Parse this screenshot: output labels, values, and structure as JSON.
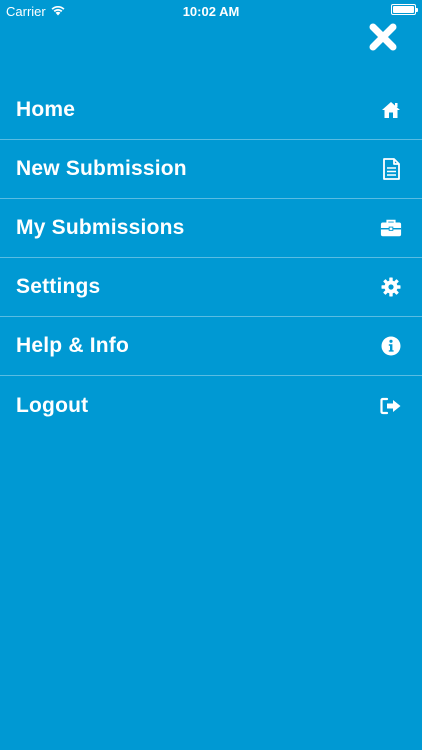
{
  "status_bar": {
    "carrier": "Carrier",
    "time": "10:02 AM"
  },
  "menu": {
    "items": [
      {
        "label": "Home",
        "icon": "home-icon"
      },
      {
        "label": "New Submission",
        "icon": "document-icon"
      },
      {
        "label": "My Submissions",
        "icon": "briefcase-icon"
      },
      {
        "label": "Settings",
        "icon": "gear-icon"
      },
      {
        "label": "Help & Info",
        "icon": "info-icon"
      },
      {
        "label": "Logout",
        "icon": "logout-icon"
      }
    ]
  },
  "colors": {
    "background": "#0099d3",
    "text": "#ffffff",
    "divider": "rgba(255,255,255,0.35)"
  }
}
